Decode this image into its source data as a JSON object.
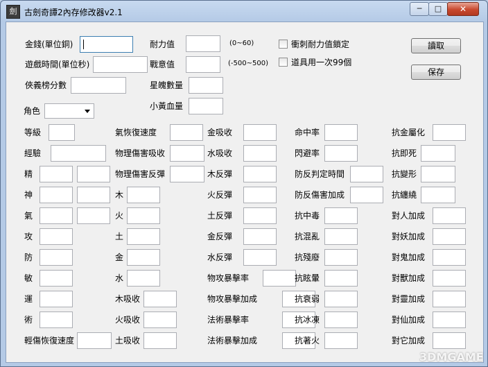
{
  "window": {
    "title": "古劍奇譚2內存修改器v2.1",
    "icon_char": "劍",
    "min_glyph": "─",
    "max_glyph": "□",
    "close_glyph": "✕"
  },
  "top": {
    "money_label": "金錢(單位銅)",
    "money_value": "",
    "playtime_label": "遊戲時間(單位秒)",
    "chivalry_label": "俠義榜分數",
    "durability_label": "耐力值",
    "durability_hint": "(0~60)",
    "fighting_label": "戰意值",
    "fighting_hint": "(-500~500)",
    "starsoul_label": "星魄數量",
    "yellowblood_label": "小黃血量",
    "lock_label": "衝刺耐力值鎖定",
    "items_label": "道具用一次99個",
    "read_button": "讀取",
    "save_button": "保存",
    "role_label": "角色",
    "role_value": ""
  },
  "col1": [
    "等級",
    "經驗",
    "精",
    "神",
    "氣",
    "攻",
    "防",
    "敏",
    "運",
    "術",
    "輕傷恢復速度"
  ],
  "col2": [
    "氣恢復速度",
    "物理傷害吸收",
    "物理傷害反彈",
    "木",
    "火",
    "土",
    "金",
    "水",
    "木吸收",
    "火吸收",
    "土吸收"
  ],
  "col3": [
    "金吸收",
    "水吸收",
    "木反彈",
    "火反彈",
    "土反彈",
    "金反彈",
    "水反彈",
    "物攻暴擊率",
    "物攻暴擊加成",
    "法術暴擊率",
    "法術暴擊加成"
  ],
  "col4": [
    "命中率",
    "閃避率",
    "防反判定時間",
    "防反傷害加成",
    "抗中毒",
    "抗混亂",
    "抗殘廢",
    "抗眩暈",
    "抗衰弱",
    "抗冰凍",
    "抗著火"
  ],
  "col5": [
    "抗金屬化",
    "抗即死",
    "抗變形",
    "抗纏繞",
    "對人加成",
    "對妖加成",
    "對鬼加成",
    "對獸加成",
    "對靈加成",
    "對仙加成",
    "對它加成"
  ],
  "watermark": "3DMGAME"
}
